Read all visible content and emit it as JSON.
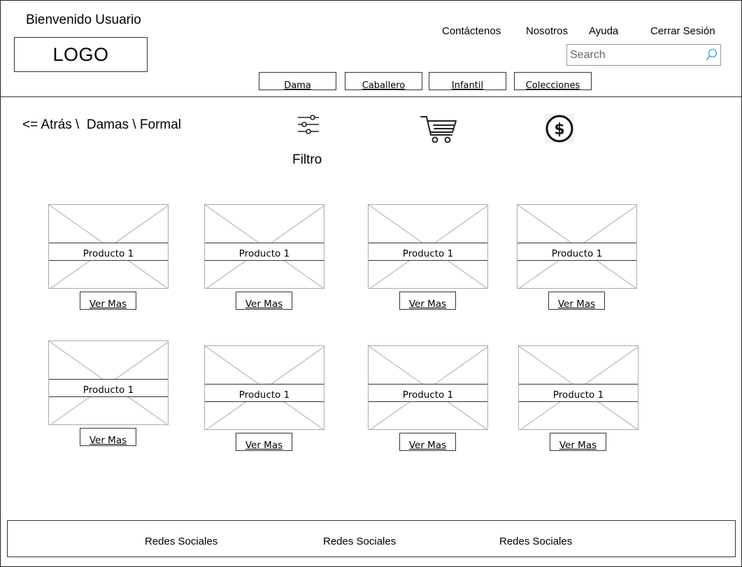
{
  "header": {
    "welcome": "Bienvenido Usuario",
    "logo": "LOGO",
    "links": [
      "Contáctenos",
      "Nosotros",
      "Ayuda",
      "Cerrar Sesión"
    ],
    "search_placeholder": "Search",
    "categories": [
      "Dama",
      "Caballero",
      "Infantil",
      "Colecciones"
    ]
  },
  "breadcrumb": "<= Atrás \\  Damas \\ Formal",
  "toolbar": {
    "filter_label": "Filtro",
    "filter_icon": "sliders-icon",
    "cart_icon": "shopping-cart-icon",
    "money_icon": "dollar-circle-icon"
  },
  "products": [
    {
      "name": "Producto 1",
      "button": "Ver Mas"
    },
    {
      "name": "Producto 1",
      "button": "Ver Mas"
    },
    {
      "name": "Producto 1",
      "button": "Ver Mas"
    },
    {
      "name": "Producto 1",
      "button": "Ver Mas"
    },
    {
      "name": "Producto 1",
      "button": "Ver Mas"
    },
    {
      "name": "Producto 1",
      "button": "Ver Mas"
    },
    {
      "name": "Producto 1",
      "button": "Ver Mas"
    },
    {
      "name": "Producto 1",
      "button": "Ver Mas"
    }
  ],
  "footer": {
    "socials": [
      "Redes Sociales",
      "Redes Sociales",
      "Redes Sociales"
    ]
  }
}
